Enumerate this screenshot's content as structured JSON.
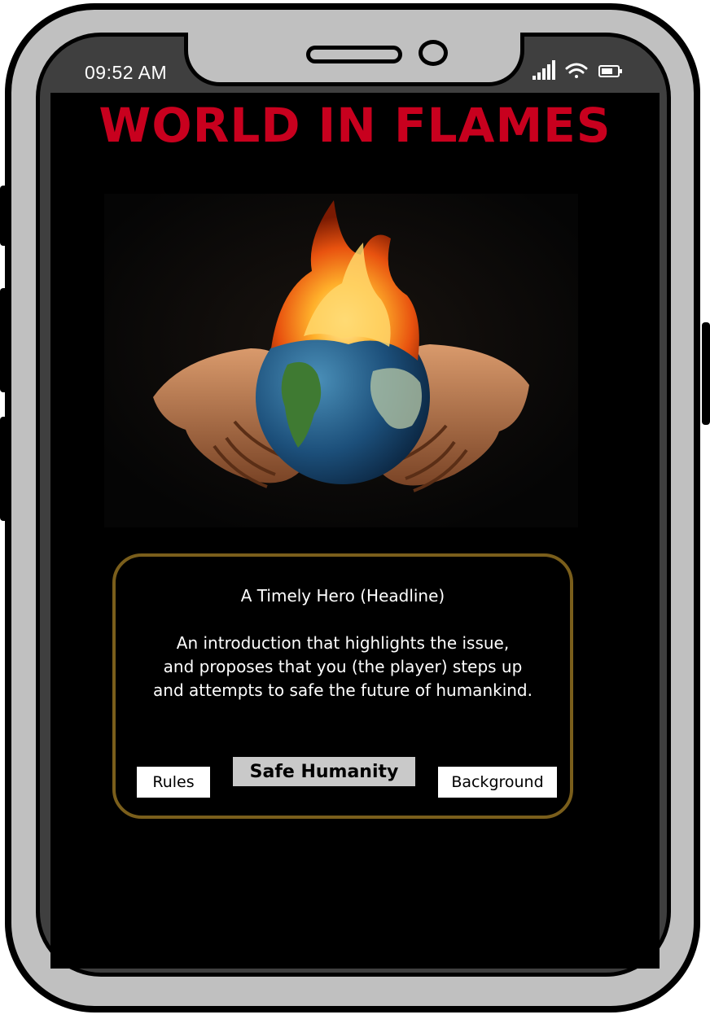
{
  "status_bar": {
    "time": "09:52 AM",
    "icons": [
      "signal-icon",
      "wifi-icon",
      "battery-icon"
    ]
  },
  "app": {
    "title": "WORLD IN FLAMES",
    "title_color": "#c8001e"
  },
  "hero": {
    "image": "hands-holding-burning-earth"
  },
  "intro": {
    "headline": "A Timely Hero (Headline)",
    "body": "An introduction that highlights the issue,\nand proposes that you (the player) steps up\nand attempts to safe the future of humankind.",
    "border_color": "#7a5e1b"
  },
  "buttons": {
    "rules": "Rules",
    "play": "Safe Humanity",
    "background": "Background"
  }
}
